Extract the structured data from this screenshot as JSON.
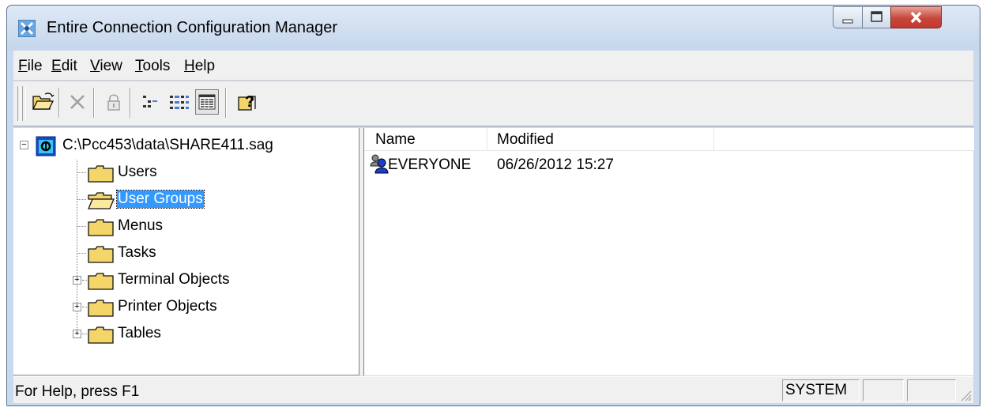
{
  "window": {
    "title": "Entire Connection Configuration Manager"
  },
  "menu": {
    "items": [
      "File",
      "Edit",
      "View",
      "Tools",
      "Help"
    ]
  },
  "toolbar": {
    "buttons": [
      "open-folder-icon",
      "delete-icon",
      "lock-icon",
      "tree-view-icon",
      "list-view-icon",
      "details-view-icon",
      "help-icon"
    ],
    "pressed": "details-view-icon"
  },
  "tree": {
    "root_label": "C:\\Pcc453\\data\\SHARE411.sag",
    "items": [
      {
        "label": "Users",
        "expandable": false
      },
      {
        "label": "User Groups",
        "expandable": false,
        "selected": true
      },
      {
        "label": "Menus",
        "expandable": false
      },
      {
        "label": "Tasks",
        "expandable": false
      },
      {
        "label": "Terminal Objects",
        "expandable": true
      },
      {
        "label": "Printer Objects",
        "expandable": true
      },
      {
        "label": "Tables",
        "expandable": true
      }
    ]
  },
  "list": {
    "columns": [
      "Name",
      "Modified"
    ],
    "rows": [
      {
        "name": "EVERYONE",
        "modified": "06/26/2012 15:27"
      }
    ]
  },
  "status": {
    "help_text": "For Help, press F1",
    "panel1": "SYSTEM",
    "panel2": "",
    "panel3": ""
  },
  "colors": {
    "selection": "#3399ff",
    "folder": "#f3d56a",
    "titlebar": "#c9d9ee",
    "close_button": "#c7453a"
  }
}
